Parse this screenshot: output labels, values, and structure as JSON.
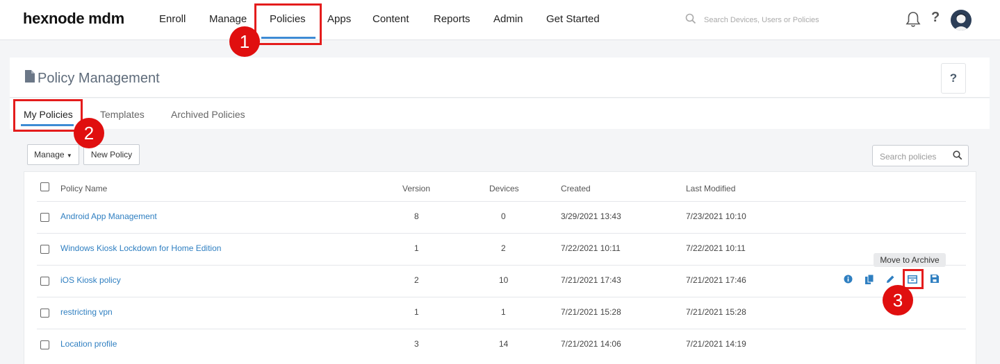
{
  "app": {
    "logo": "hexnode mdm"
  },
  "nav": {
    "items": [
      "Enroll",
      "Manage",
      "Policies",
      "Apps",
      "Content",
      "Reports",
      "Admin",
      "Get Started"
    ],
    "search_placeholder": "Search Devices, Users or Policies",
    "help": "?"
  },
  "page": {
    "title": "Policy Management",
    "help": "?"
  },
  "tabs": [
    "My Policies",
    "Templates",
    "Archived Policies"
  ],
  "toolbar": {
    "manage_label": "Manage",
    "new_policy_label": "New Policy",
    "search_placeholder": "Search policies"
  },
  "table": {
    "headers": {
      "name": "Policy Name",
      "version": "Version",
      "devices": "Devices",
      "created": "Created",
      "modified": "Last Modified"
    },
    "rows": [
      {
        "name": "Android App Management",
        "version": "8",
        "devices": "0",
        "created": "3/29/2021 13:43",
        "modified": "7/23/2021 10:10"
      },
      {
        "name": "Windows Kiosk Lockdown for Home Edition",
        "version": "1",
        "devices": "2",
        "created": "7/22/2021 10:11",
        "modified": "7/22/2021 10:11"
      },
      {
        "name": "iOS Kiosk policy",
        "version": "2",
        "devices": "10",
        "created": "7/21/2021 17:43",
        "modified": "7/21/2021 17:46"
      },
      {
        "name": "restricting vpn",
        "version": "1",
        "devices": "1",
        "created": "7/21/2021 15:28",
        "modified": "7/21/2021 15:28"
      },
      {
        "name": "Location profile",
        "version": "3",
        "devices": "14",
        "created": "7/21/2021 14:06",
        "modified": "7/21/2021 14:19"
      }
    ]
  },
  "tooltip": "Move to Archive",
  "annotations": [
    "1",
    "2",
    "3"
  ],
  "colors": {
    "accent": "#3d8bd4",
    "link": "#2f7fc1",
    "highlight": "#e41c1c"
  }
}
